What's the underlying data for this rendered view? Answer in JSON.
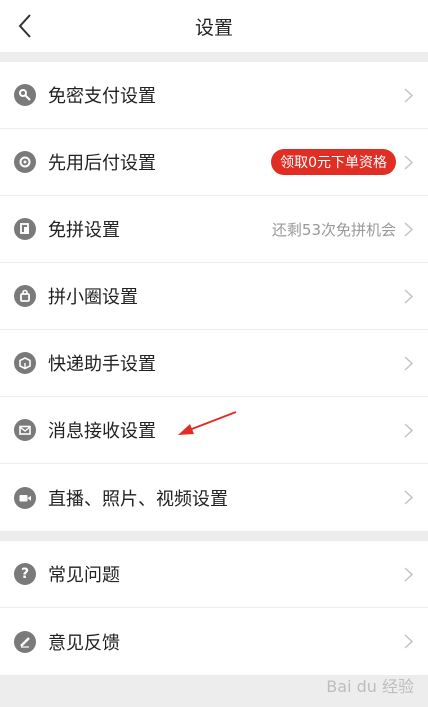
{
  "header": {
    "title": "设置"
  },
  "group1": [
    {
      "label": "免密支付设置",
      "icon": "key-icon"
    },
    {
      "label": "先用后付设置",
      "icon": "gear-badge-icon",
      "badge": "领取0元下单资格"
    },
    {
      "label": "免拼设置",
      "icon": "copy-icon",
      "hint": "还剩53次免拼机会"
    },
    {
      "label": "拼小圈设置",
      "icon": "lock-bag-icon"
    },
    {
      "label": "快递助手设置",
      "icon": "package-icon"
    },
    {
      "label": "消息接收设置",
      "icon": "mail-icon"
    },
    {
      "label": "直播、照片、视频设置",
      "icon": "video-icon"
    }
  ],
  "group2": [
    {
      "label": "常见问题",
      "icon": "question-icon"
    },
    {
      "label": "意见反馈",
      "icon": "pencil-icon"
    }
  ],
  "annotation": {
    "arrow_color": "#e02e24"
  },
  "colors": {
    "accent": "#e02e24",
    "icon_bg": "#7a7a7a",
    "background": "#ededed"
  }
}
